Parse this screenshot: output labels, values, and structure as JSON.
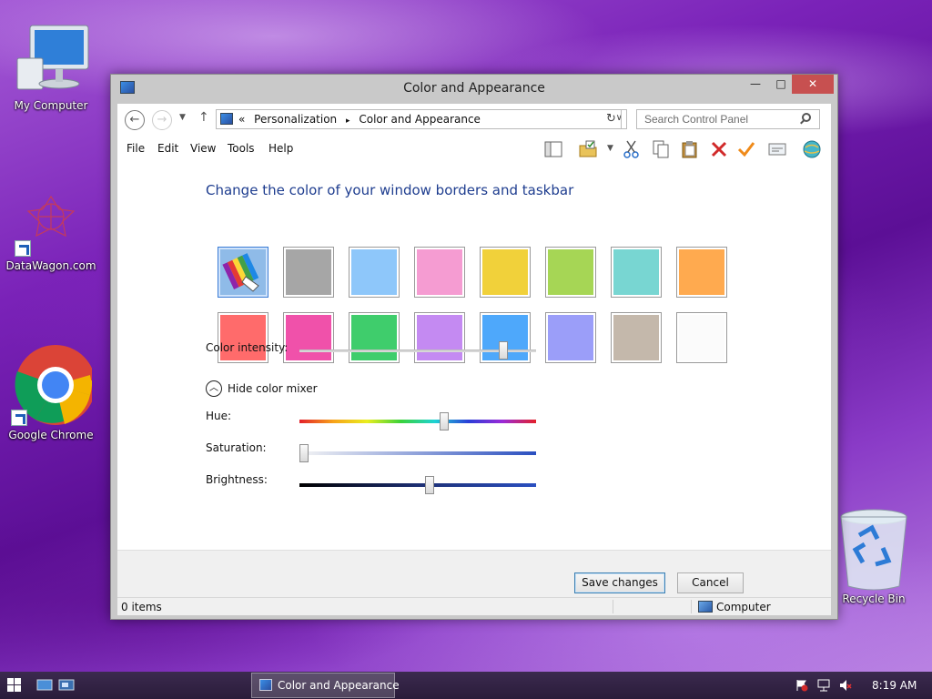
{
  "desktop": {
    "icons": [
      {
        "label": "My Computer"
      },
      {
        "label": "DataWagon.com"
      },
      {
        "label": "Google Chrome"
      },
      {
        "label": "Recycle Bin"
      }
    ]
  },
  "window": {
    "title": "Color and Appearance",
    "controls": {
      "minimize": "—",
      "maximize": "□",
      "close": "✕"
    }
  },
  "address": {
    "prefix": "«",
    "breadcrumbs": [
      "Personalization",
      "▸",
      "Color and Appearance"
    ],
    "search_placeholder": "Search Control Panel"
  },
  "menu": [
    "File",
    "Edit",
    "View",
    "Tools",
    "Help"
  ],
  "content": {
    "heading": "Change the color of your window borders and taskbar",
    "swatches": [
      {
        "name": "automatic",
        "color": "#8fbbe8",
        "selected": true
      },
      {
        "name": "gray",
        "color": "#a6a6a6"
      },
      {
        "name": "sky-blue",
        "color": "#8ec7fa"
      },
      {
        "name": "pink",
        "color": "#f59cd2"
      },
      {
        "name": "yellow",
        "color": "#f1d13a"
      },
      {
        "name": "lime",
        "color": "#a6d655"
      },
      {
        "name": "teal",
        "color": "#78d6d2"
      },
      {
        "name": "orange",
        "color": "#ffaa4f"
      },
      {
        "name": "red",
        "color": "#ff6b6b"
      },
      {
        "name": "magenta",
        "color": "#f051aa"
      },
      {
        "name": "green",
        "color": "#3fcd6c"
      },
      {
        "name": "lavender",
        "color": "#c48af2"
      },
      {
        "name": "blue",
        "color": "#4ea8fb"
      },
      {
        "name": "periwinkle",
        "color": "#9b9ef9"
      },
      {
        "name": "taupe",
        "color": "#c4b8ab"
      },
      {
        "name": "white",
        "color": "#fbfbfb"
      }
    ],
    "color_intensity": {
      "label": "Color intensity:",
      "value": 0.86
    },
    "mixer_toggle": "Hide color mixer",
    "hue": {
      "label": "Hue:",
      "value": 0.61
    },
    "saturation": {
      "label": "Saturation:",
      "value": 0.0
    },
    "brightness": {
      "label": "Brightness:",
      "value": 0.55
    }
  },
  "buttons": {
    "save": "Save changes",
    "cancel": "Cancel"
  },
  "statusbar": {
    "items": "0 items",
    "location": "Computer"
  },
  "taskbar": {
    "active_task": "Color and Appearance",
    "clock": "8:19 AM"
  }
}
